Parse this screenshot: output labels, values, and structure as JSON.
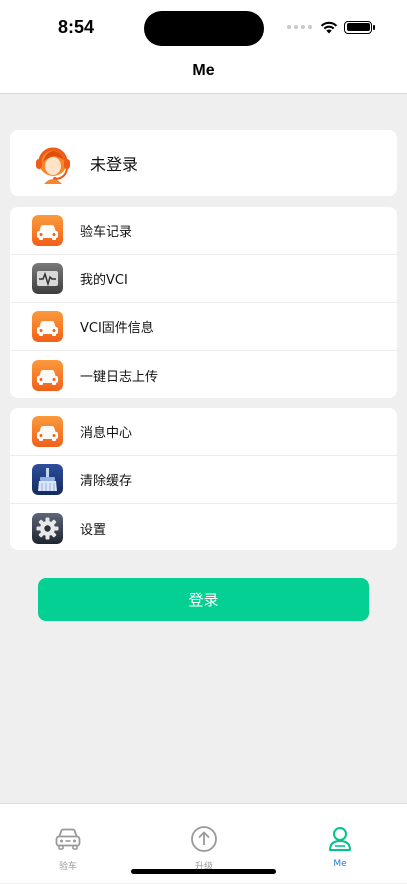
{
  "status_bar": {
    "time": "8:54"
  },
  "nav": {
    "title": "Me"
  },
  "profile": {
    "name": "未登录"
  },
  "menu_group_1": [
    {
      "label": "验车记录",
      "icon": "car-icon"
    },
    {
      "label": "我的VCI",
      "icon": "vci-device-icon"
    },
    {
      "label": "VCI固件信息",
      "icon": "car-icon"
    },
    {
      "label": "一键日志上传",
      "icon": "car-icon"
    }
  ],
  "menu_group_2": [
    {
      "label": "消息中心",
      "icon": "car-icon"
    },
    {
      "label": "清除缓存",
      "icon": "brush-icon"
    },
    {
      "label": "设置",
      "icon": "gear-icon"
    }
  ],
  "login_button": {
    "label": "登录"
  },
  "tabs": [
    {
      "label": "验车",
      "icon": "car-outline-icon",
      "active": false
    },
    {
      "label": "升级",
      "icon": "upload-arrow-icon",
      "active": false
    },
    {
      "label": "Me",
      "icon": "user-icon",
      "active": true
    }
  ],
  "colors": {
    "accent_green": "#03d092",
    "active_tab_blue": "#1e7bd8",
    "orange_icon": "#f5701f",
    "background": "#efefef"
  }
}
